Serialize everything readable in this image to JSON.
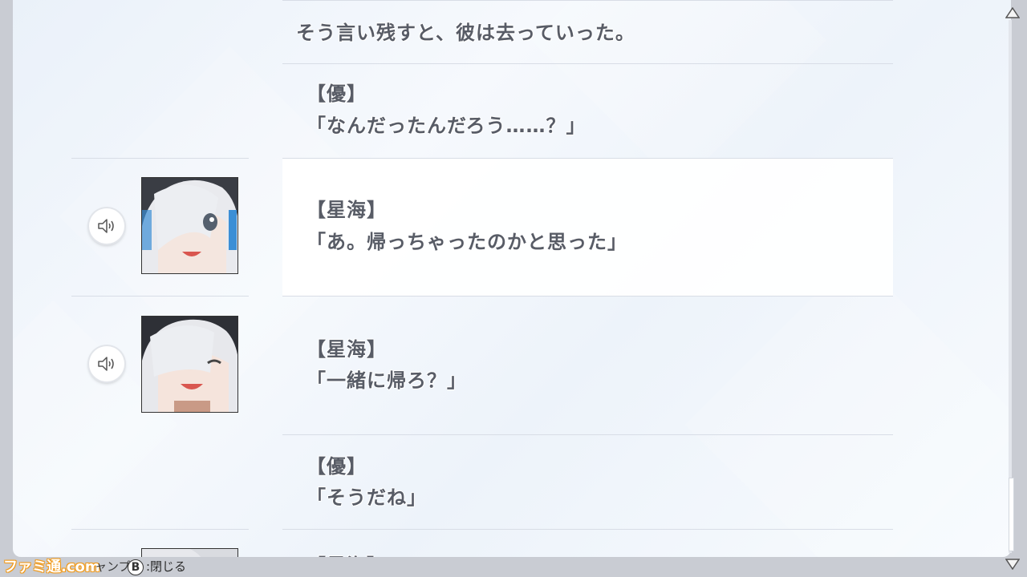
{
  "log": {
    "entries": [
      {
        "type": "narration",
        "text": "そう言い残すと、彼は去っていった。"
      },
      {
        "type": "dialogue",
        "speaker": "【優】",
        "line": "「なんだったんだろう……？」"
      },
      {
        "type": "dialogue",
        "speaker": "【星海】",
        "line": "「あ。帰っちゃったのかと思った」",
        "has_voice": true,
        "highlighted": true
      },
      {
        "type": "dialogue",
        "speaker": "【星海】",
        "line": "「一緒に帰ろ？」",
        "has_voice": true
      },
      {
        "type": "dialogue",
        "speaker": "【優】",
        "line": "「そうだね」"
      },
      {
        "type": "dialogue",
        "speaker": "【星海】",
        "line": "",
        "has_voice": true
      }
    ]
  },
  "footer": {
    "logo": "ファミ通.com",
    "hint_jump": "ャンプ",
    "b_button": "B",
    "hint_close": ":閉じる"
  },
  "icons": {
    "voice": "speaker-icon",
    "scroll_up": "triangle-up-icon",
    "scroll_down": "triangle-down-icon"
  },
  "colors": {
    "text": "#585c66",
    "panel": "#f3f7fc",
    "highlight": "#ffffff",
    "logo_accent": "#f29b1c"
  }
}
